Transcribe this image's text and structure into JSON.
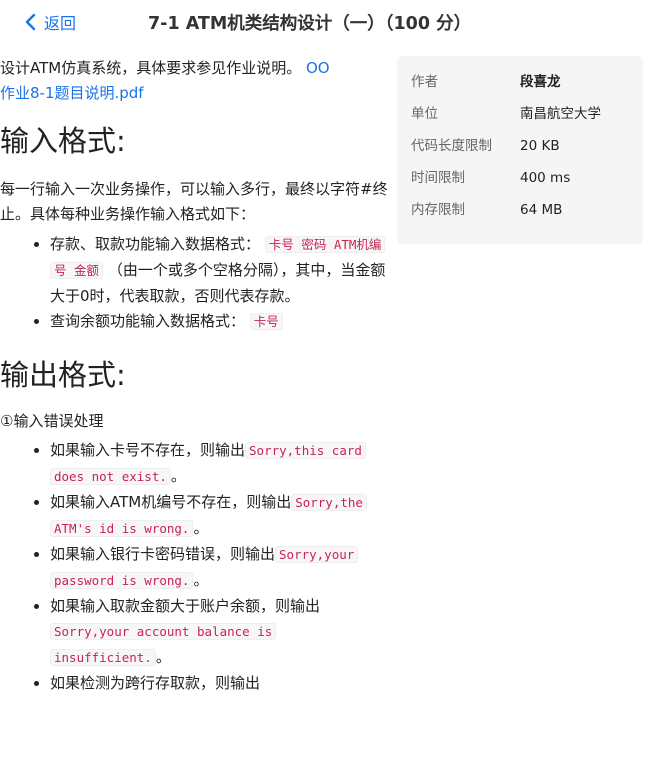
{
  "header": {
    "back_label": "返回",
    "title": "7-1 ATM机类结构设计（一）（100 分）"
  },
  "info": {
    "rows": [
      {
        "key": "作者",
        "value": "段喜龙"
      },
      {
        "key": "单位",
        "value": "南昌航空大学"
      },
      {
        "key": "代码长度限制",
        "value": "20 KB"
      },
      {
        "key": "时间限制",
        "value": "400 ms"
      },
      {
        "key": "内存限制",
        "value": "64 MB"
      }
    ]
  },
  "intro": {
    "text": "设计ATM仿真系统，具体要求参见作业说明。",
    "link_icon": "OO",
    "link_text": "作业8-1题目说明.pdf"
  },
  "input_section": {
    "heading": "输入格式:",
    "desc": "每一行输入一次业务操作，可以输入多行，最终以字符#终止。具体每种业务操作输入格式如下：",
    "items": [
      {
        "prefix": "存款、取款功能输入数据格式：",
        "code": "卡号 密码 ATM机编号 金额",
        "suffix": "（由一个或多个空格分隔），其中，当金额大于0时，代表取款，否则代表存款。"
      },
      {
        "prefix": "查询余额功能输入数据格式：",
        "code": "卡号",
        "suffix": ""
      }
    ]
  },
  "output_section": {
    "heading": "输出格式:",
    "subheading": "①输入错误处理",
    "items": [
      {
        "prefix": "如果输入卡号不存在，则输出",
        "code": "Sorry,this card does not exist.",
        "suffix": "。"
      },
      {
        "prefix": "如果输入ATM机编号不存在，则输出",
        "code": "Sorry,the ATM's id is wrong.",
        "suffix": "。"
      },
      {
        "prefix": "如果输入银行卡密码错误，则输出",
        "code": "Sorry,your password is wrong.",
        "suffix": "。"
      },
      {
        "prefix": "如果输入取款金额大于账户余额，则输出",
        "code": "Sorry,your account balance is insufficient.",
        "suffix": "。"
      },
      {
        "prefix": "如果检测为跨行存取款，则输出",
        "code": "",
        "suffix": ""
      }
    ]
  }
}
